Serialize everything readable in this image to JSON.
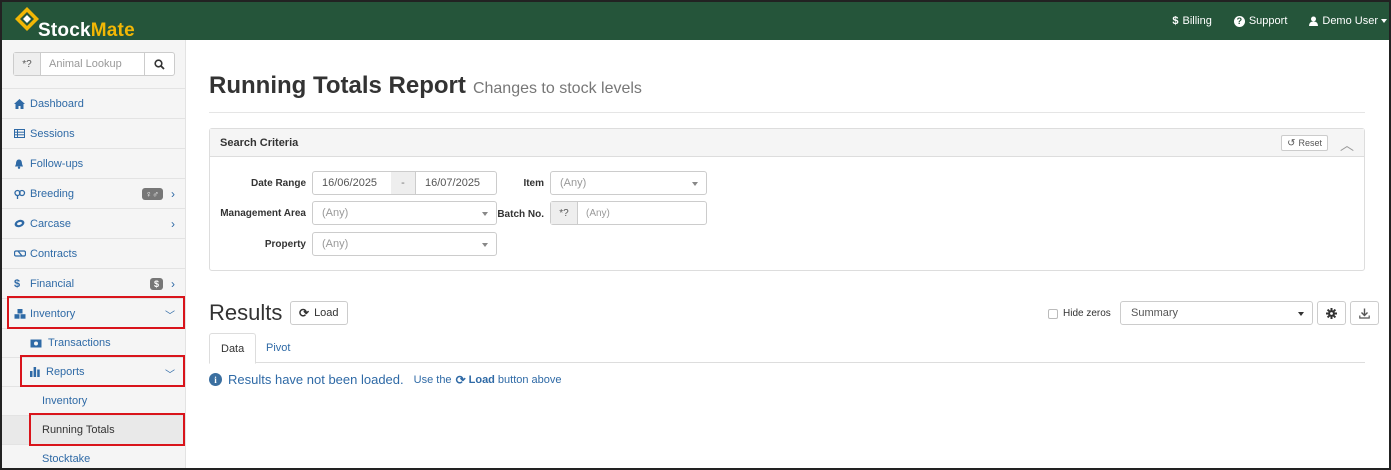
{
  "app": {
    "logo_stock": "Stock",
    "logo_mate": "Mate",
    "colors": {
      "header": "#25553a",
      "accent": "#f2b705",
      "link": "#2f6aa6",
      "highlight": "#d9141b"
    }
  },
  "topnav": {
    "billing": "Billing",
    "support": "Support",
    "user": "Demo User"
  },
  "sidebar": {
    "lookup_prefix": "*?",
    "lookup_placeholder": "Animal Lookup",
    "items": {
      "dashboard": "Dashboard",
      "sessions": "Sessions",
      "followups": "Follow-ups",
      "breeding": "Breeding",
      "breeding_badge": "♀♂",
      "carcase": "Carcase",
      "contracts": "Contracts",
      "financial": "Financial",
      "financial_badge": "$",
      "inventory": "Inventory",
      "transactions": "Transactions",
      "reports": "Reports",
      "rep_inventory": "Inventory",
      "running_totals": "Running Totals",
      "stocktake": "Stocktake"
    }
  },
  "page": {
    "title": "Running Totals Report",
    "subtitle": "Changes to stock levels"
  },
  "search": {
    "header": "Search Criteria",
    "reset": "Reset",
    "labels": {
      "date_range": "Date Range",
      "management_area": "Management Area",
      "property": "Property",
      "item": "Item",
      "batch_no": "Batch No."
    },
    "date_from": "16/06/2025",
    "date_sep": "-",
    "date_to": "16/07/2025",
    "any": "(Any)",
    "batch_prefix": "*?"
  },
  "results": {
    "title": "Results",
    "load": "Load",
    "hide_zeros": "Hide zeros",
    "view_select": "Summary",
    "tabs": {
      "data": "Data",
      "pivot": "Pivot"
    },
    "msg_main": "Results have not been loaded.",
    "msg_use": "Use the",
    "msg_load": "Load",
    "msg_after": "button above"
  }
}
